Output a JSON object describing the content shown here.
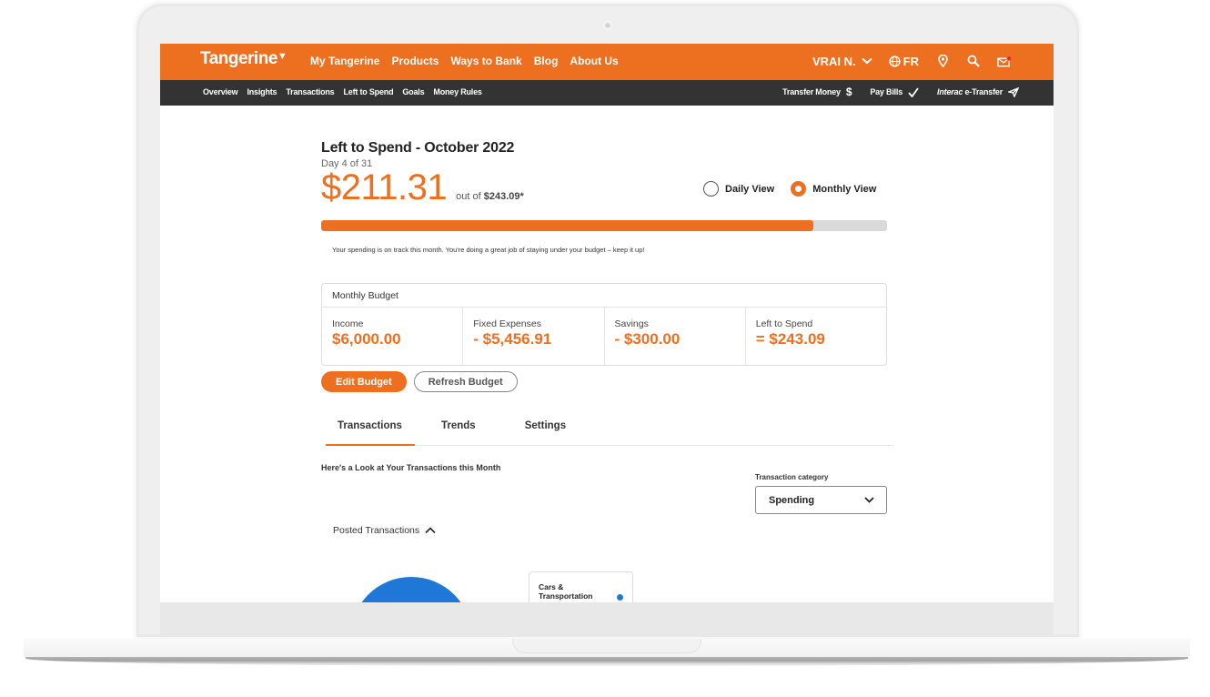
{
  "brand": {
    "name": "Tangerine",
    "accent": "#ed7021",
    "subnav_bg": "#333333",
    "chart_blue": "#1f78d8"
  },
  "topnav": {
    "links": [
      "My Tangerine",
      "Products",
      "Ways to Bank",
      "Blog",
      "About Us"
    ],
    "user": "VRAI N.",
    "language": "FR",
    "icons": [
      "globe-icon",
      "location-pin-icon",
      "search-icon",
      "mail-notification-icon"
    ]
  },
  "subnav": {
    "links": [
      "Overview",
      "Insights",
      "Transactions",
      "Left to Spend",
      "Goals",
      "Money Rules"
    ],
    "actions": [
      {
        "label": "Transfer Money",
        "icon": "dollar-icon"
      },
      {
        "label": "Pay Bills",
        "icon": "checkmark-icon"
      },
      {
        "label_italic": "Interac",
        "label": " e-Transfer",
        "icon": "paper-plane-icon"
      }
    ]
  },
  "summary": {
    "title": "Left to Spend - October 2022",
    "day": "Day 4 of 31",
    "amount": "$211.31",
    "out_of_prefix": "out of",
    "out_of_value": "$243.09*",
    "progress_fraction": 0.869,
    "message": "Your spending is on track this month. You're doing a great job of staying under your budget – keep it up!"
  },
  "views": {
    "options": [
      {
        "label": "Daily View",
        "selected": false
      },
      {
        "label": "Monthly View",
        "selected": true
      }
    ]
  },
  "budget": {
    "title": "Monthly Budget",
    "cells": [
      {
        "label": "Income",
        "value": "$6,000.00"
      },
      {
        "label": "Fixed Expenses",
        "value": "- $5,456.91"
      },
      {
        "label": "Savings",
        "value": "- $300.00"
      },
      {
        "label": "Left to Spend",
        "value": "= $243.09"
      }
    ]
  },
  "buttons": {
    "edit": "Edit Budget",
    "refresh": "Refresh Budget"
  },
  "tabs": [
    {
      "label": "Transactions",
      "active": true
    },
    {
      "label": "Trends",
      "active": false
    },
    {
      "label": "Settings",
      "active": false
    }
  ],
  "transactions": {
    "heading": "Here's a Look at Your Transactions this Month",
    "category_label": "Transaction category",
    "category_value": "Spending",
    "posted_label": "Posted Transactions",
    "legend": [
      {
        "label": "Cars & Transportation",
        "color": "#1f78d8"
      }
    ]
  }
}
